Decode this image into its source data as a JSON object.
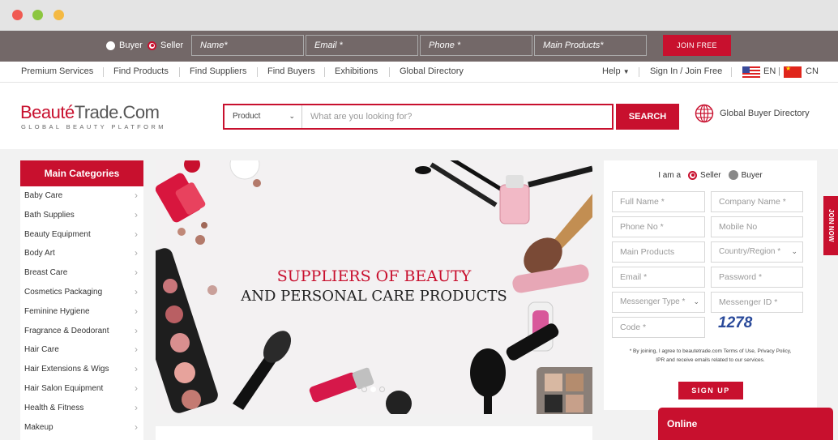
{
  "window": {
    "traffic_lights": [
      "close",
      "minimize",
      "zoom"
    ]
  },
  "register_bar": {
    "roles": [
      "Buyer",
      "Seller"
    ],
    "selected_role": "Seller",
    "fields": [
      "Name*",
      "Email *",
      "Phone *",
      "Main Products*"
    ],
    "join_label": "JOIN FREE"
  },
  "nav": {
    "left": [
      "Premium Services",
      "Find Products",
      "Find Suppliers",
      "Find Buyers",
      "Exhibitions",
      "Global Directory"
    ],
    "help": "Help",
    "signin": "Sign In / Join Free",
    "lang_en": "EN",
    "lang_sep": "|",
    "lang_cn": "CN"
  },
  "header": {
    "logo_main": "Beauté",
    "logo_rest": "Trade.Com",
    "logo_tagline": "GLOBAL BEAUTY PLATFORM",
    "search_category": "Product",
    "search_placeholder": "What are you looking for?",
    "search_button": "SEARCH",
    "directory_label": "Global Buyer Directory"
  },
  "sidebar": {
    "title": "Main Categories",
    "items": [
      "Baby Care",
      "Bath Supplies",
      "Beauty Equipment",
      "Body Art",
      "Breast Care",
      "Cosmetics Packaging",
      "Feminine Hygiene",
      "Fragrance & Deodorant",
      "Hair Care",
      "Hair Extensions & Wigs",
      "Hair Salon Equipment",
      "Health & Fitness",
      "Makeup"
    ]
  },
  "banner": {
    "line1": "SUPPLIERS OF BEAUTY",
    "line2": "AND PERSONAL CARE PRODUCTS",
    "slide_count": 3,
    "active_slide": 2
  },
  "signup_form": {
    "iam_label": "I am a",
    "roles": [
      "Seller",
      "Buyer"
    ],
    "selected_role": "Seller",
    "full_name": "Full Name *",
    "company_name": "Company Name *",
    "phone_no": "Phone No *",
    "mobile_no": "Mobile No",
    "main_products": "Main Products",
    "country_region": "Country/Region *",
    "email": "Email *",
    "password": "Password *",
    "messenger_type": "Messenger Type *",
    "messenger_id": "Messenger ID *",
    "code": "Code *",
    "captcha": "1278",
    "terms_line1": "* By joining, I agree to beautetrade.com Terms of Use, Privacy Policy,",
    "terms_line2": "IPR and receive emails related to our services.",
    "submit": "SIGN UP"
  },
  "join_now_tab": "JOIN NOW",
  "chat_widget": "Online",
  "colors": {
    "brand_red": "#c8102e",
    "topbar_gray": "#736868"
  }
}
